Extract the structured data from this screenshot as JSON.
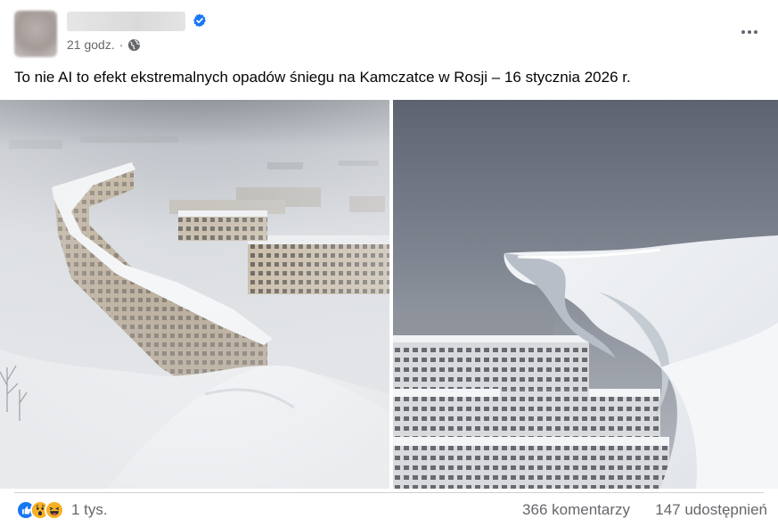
{
  "post": {
    "timestamp": "21 godz.",
    "separator": "·",
    "privacy_icon": "globe-icon",
    "verified_icon": "verified-badge-icon",
    "menu_icon": "more-options-icon",
    "text": "To nie AI to efekt ekstremalnych opadów śniegu na Kamczatce w Rosji – 16 stycznia 2026 r."
  },
  "photos": [
    {
      "icon": "photo-snow-buildings-aerial"
    },
    {
      "icon": "photo-snow-wave-buildings"
    }
  ],
  "footer": {
    "reaction_icons": [
      "like-icon",
      "wow-icon",
      "haha-icon"
    ],
    "reaction_count": "1 tys.",
    "comments": "366 komentarzy",
    "shares": "147 udostępnień"
  },
  "colors": {
    "verified_blue": "#1877f2",
    "secondary_text": "#65676b",
    "like_blue": "#1877f2",
    "emoji_yellow": "#f7b125"
  }
}
